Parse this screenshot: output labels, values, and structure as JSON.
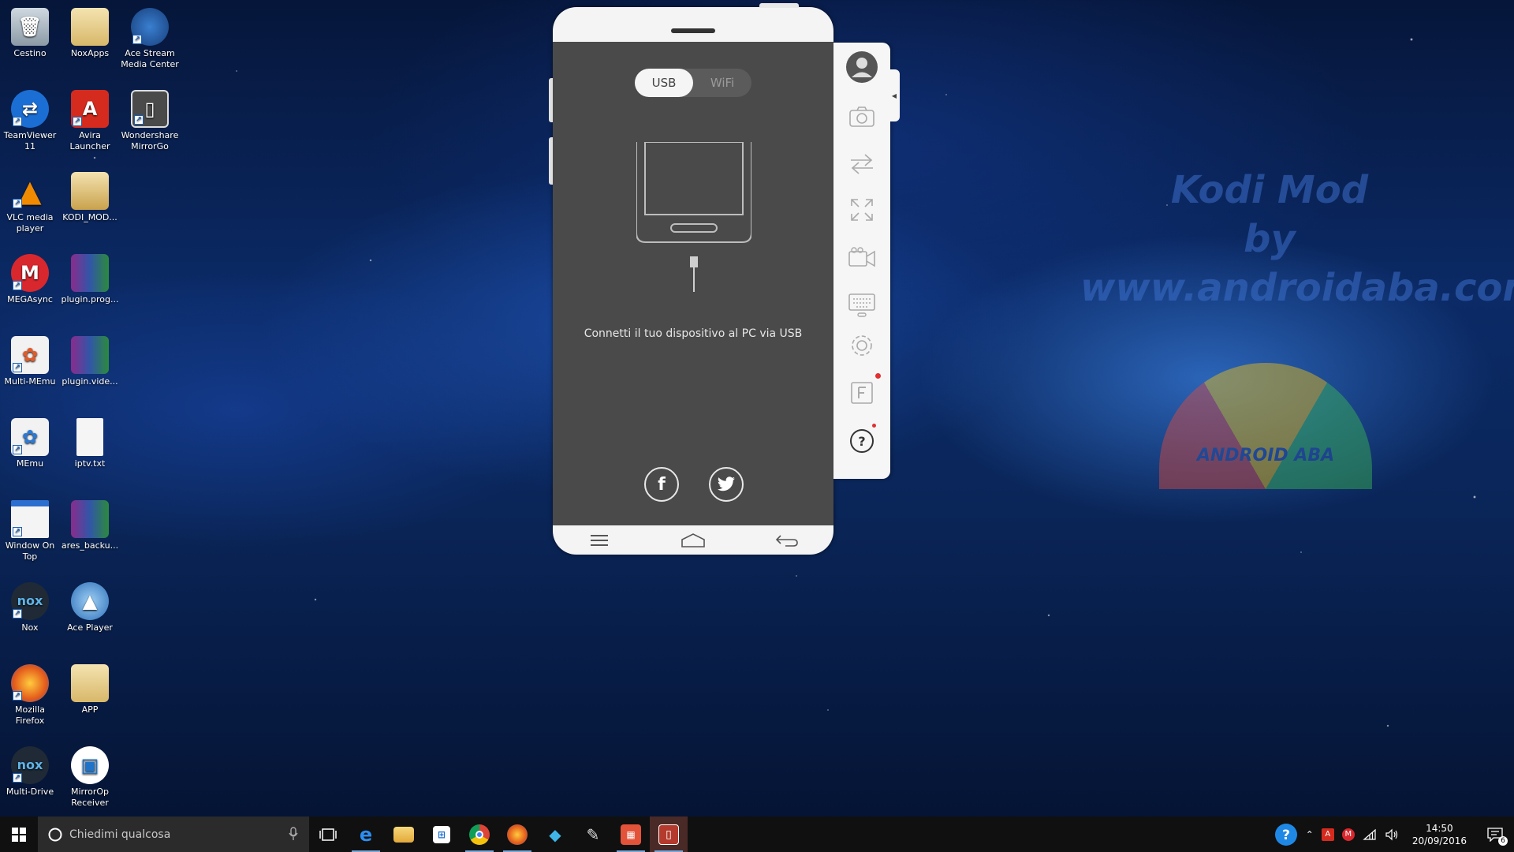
{
  "desktop": {
    "icons": [
      {
        "label": "Cestino",
        "icon": "recycle-bin-icon"
      },
      {
        "label": "NoxApps",
        "icon": "folder-icon"
      },
      {
        "label": "Ace Stream Media Center",
        "icon": "ace-stream-icon"
      },
      {
        "label": "TeamViewer 11",
        "icon": "teamviewer-icon"
      },
      {
        "label": "Avira Launcher",
        "icon": "avira-icon"
      },
      {
        "label": "Wondershare MirrorGo",
        "icon": "mirrorgo-icon"
      },
      {
        "label": "VLC media player",
        "icon": "vlc-icon"
      },
      {
        "label": "KODI_MOD...",
        "icon": "zip-folder-icon"
      },
      {
        "label": "MEGAsync",
        "icon": "mega-icon"
      },
      {
        "label": "plugin.prog...",
        "icon": "winrar-icon"
      },
      {
        "label": "Multi-MEmu",
        "icon": "multi-memu-icon"
      },
      {
        "label": "plugin.vide...",
        "icon": "winrar-icon"
      },
      {
        "label": "MEmu",
        "icon": "memu-icon"
      },
      {
        "label": "iptv.txt",
        "icon": "text-file-icon"
      },
      {
        "label": "Window On Top",
        "icon": "window-on-top-icon"
      },
      {
        "label": "ares_backu...",
        "icon": "winrar-icon"
      },
      {
        "label": "Nox",
        "icon": "nox-icon"
      },
      {
        "label": "Ace Player",
        "icon": "ace-player-icon"
      },
      {
        "label": "Mozilla Firefox",
        "icon": "firefox-icon"
      },
      {
        "label": "APP",
        "icon": "folder-icon"
      },
      {
        "label": "Multi-Drive",
        "icon": "nox-icon"
      },
      {
        "label": "MirrorOp Receiver",
        "icon": "mirrorop-icon"
      }
    ],
    "watermark": {
      "line1": "Kodi Mod",
      "line2": "by",
      "line3": "www.androidaba.com"
    },
    "logo_text": "ANDROID ABA"
  },
  "mirrorgo": {
    "tabs": [
      {
        "label": "USB",
        "active": true
      },
      {
        "label": "WiFi",
        "active": false
      }
    ],
    "connect_message": "Connetti il tuo dispositivo al PC via USB",
    "social": [
      "facebook-icon",
      "twitter-icon"
    ],
    "navbar": [
      "menu-icon",
      "home-icon",
      "back-icon"
    ],
    "toolbar": [
      "avatar-icon",
      "camera-icon",
      "transfer-icon",
      "fullscreen-icon",
      "record-icon",
      "keyboard-icon",
      "settings-icon",
      "file-icon",
      "help-icon"
    ]
  },
  "taskbar": {
    "search_placeholder": "Chiedimi qualcosa",
    "apps": [
      "task-view-icon",
      "edge-icon",
      "file-explorer-icon",
      "store-icon",
      "chrome-icon",
      "firefox-icon",
      "kodi-icon",
      "paint-icon",
      "calendar-app-icon",
      "mirrorgo-icon"
    ],
    "clock_time": "14:50",
    "clock_date": "20/09/2016",
    "notification_count": "6"
  },
  "colors": {
    "screen_bg": "#4a4a4a",
    "phone_frame": "#f4f4f4",
    "taskbar_bg": "#101010",
    "active_app": "#4a2a26",
    "accent_blue": "#0a63c9"
  }
}
